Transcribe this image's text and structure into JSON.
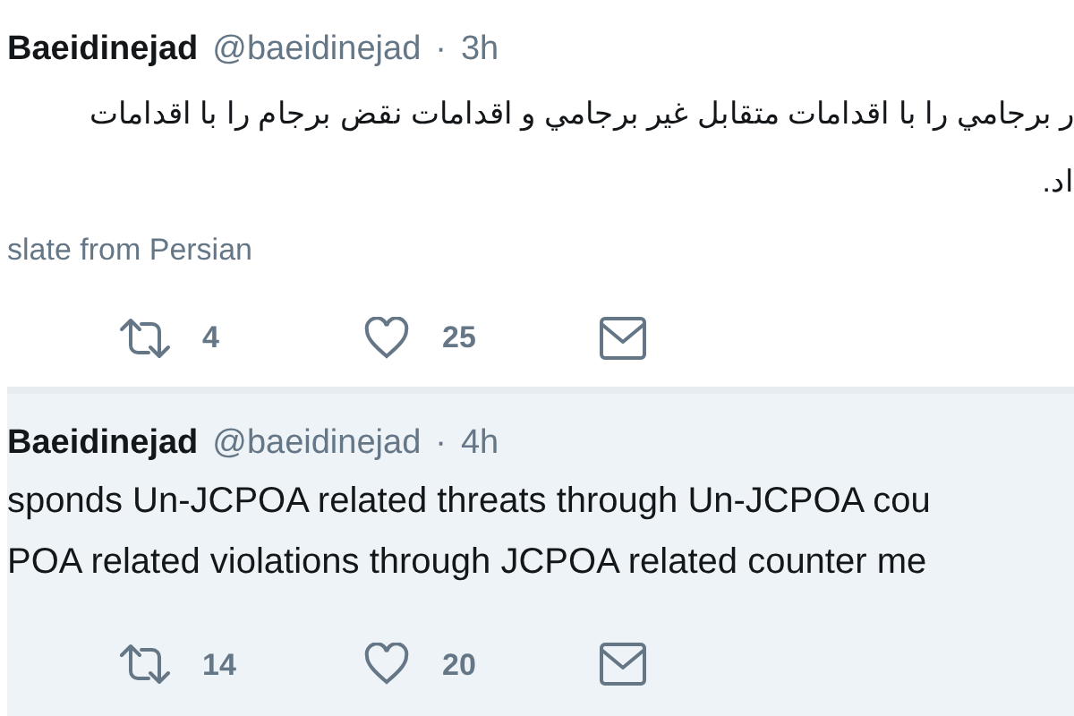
{
  "tweets": [
    {
      "name": "Baeidinejad",
      "handle": "@baeidinejad",
      "separator": "·",
      "time": "3h",
      "rtl": true,
      "lines": [
        "ر برجامي را با اقدامات متقابل غير برجامي و اقدامات نقض برجام را با اقدامات",
        "اد."
      ],
      "translate": "slate from Persian",
      "retweets": "4",
      "likes": "25",
      "highlighted": false
    },
    {
      "name": "Baeidinejad",
      "handle": "@baeidinejad",
      "separator": "·",
      "time": "4h",
      "rtl": false,
      "lines": [
        "sponds Un-JCPOA related threats through Un-JCPOA cou",
        "POA related violations through JCPOA related counter me"
      ],
      "retweets": "14",
      "likes": "20",
      "highlighted": true
    }
  ]
}
